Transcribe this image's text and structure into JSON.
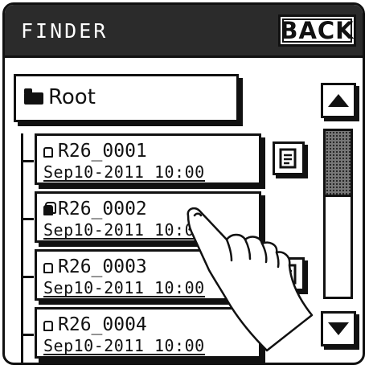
{
  "header": {
    "title": "FINDER",
    "back_label": "BACK"
  },
  "root": {
    "label": "Root",
    "icon": "folder-icon"
  },
  "files": [
    {
      "name": "R26_0001",
      "date": "Sep10-2011  10:00",
      "icon": "file-icon",
      "locked": false
    },
    {
      "name": "R26_0002",
      "date": "Sep10-2011  10:00",
      "icon": "protected-file-icon",
      "locked": true
    },
    {
      "name": "R26_0003",
      "date": "Sep10-2011  10:00",
      "icon": "file-icon",
      "locked": false
    },
    {
      "name": "R26_0004",
      "date": "Sep10-2011  10:00",
      "icon": "file-icon",
      "locked": false
    }
  ],
  "scrollbar": {
    "thumb_fraction": 0.4
  },
  "overlay": {
    "icon": "tapping-hand-icon"
  }
}
